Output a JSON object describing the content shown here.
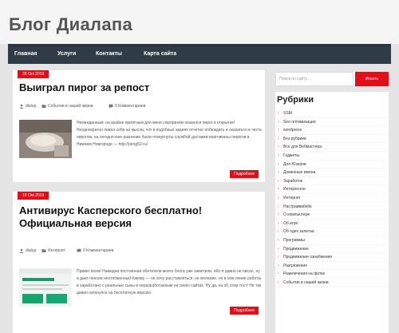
{
  "site": {
    "title": "Блог Диалапа"
  },
  "nav": {
    "items": [
      {
        "label": "Главная"
      },
      {
        "label": "Услуги"
      },
      {
        "label": "Контакты"
      },
      {
        "label": "Карта сайта"
      }
    ]
  },
  "posts": [
    {
      "date": "28 Oct 2016",
      "title": "Выиграл пирог за репост",
      "author": "dialup",
      "category": "События в нашей жизни",
      "comments": "0 Комментариев",
      "excerpt": "Неожиданным, на крайне приятным для меня сюрпризом оказался пирог в открытке! Неоднократно пивал себя на мысли, что в подобных акциях отчетно побеждать и оказаться в честь пирогом, на сегодня мне разнение были отвергнуты службой доставки вкатчиканы пирогов в Нижнем Новгороде — http://pirog52.ru/",
      "more": "Подробнее"
    },
    {
      "date": "18 Okt 2016",
      "title": "Антивирус Касперского бесплатно! Официальная версия",
      "author": "dialup",
      "category": "Интернет",
      "comments": "0 Комментариев",
      "excerpt": "Привет всем! Намедни постоянная обитатели моего блога уже заметили, ибо я давно не писал, ну и дает пенсии неотложенный Какову — не хочу расставляться, не желание, но в нов-ление работы в заработано с реальные сыны в неразработанным на своих сайтах. Ну да, на об этом тост! Не так давно наткнулся на бесплатную версию",
      "more": "Подробнее"
    }
  ],
  "search": {
    "placeholder": "Поиск по сайту…",
    "button": "Искать"
  },
  "widget": {
    "title": "Рубрики",
    "categories": [
      "SSM",
      "Seo оптимизация",
      "wordpress",
      "Без рубрики",
      "Все для Вебмастера",
      "Гаджеты",
      "Для Юзеров",
      "Доменные имена",
      "Заработок",
      "Интересное",
      "Интернет",
      "Настраивабеllо",
      "О компьютере",
      "Об игре",
      "Об одех залетаа",
      "Программы",
      "Продвижение",
      "Продвижение ознабжения",
      "Разгрежение",
      "Развлечения на фотке",
      "События в нашей жизни"
    ]
  },
  "colors": {
    "accent": "#e00f18",
    "nav_bg": "#2f3b47",
    "page_bg": "#e5e5e5"
  }
}
